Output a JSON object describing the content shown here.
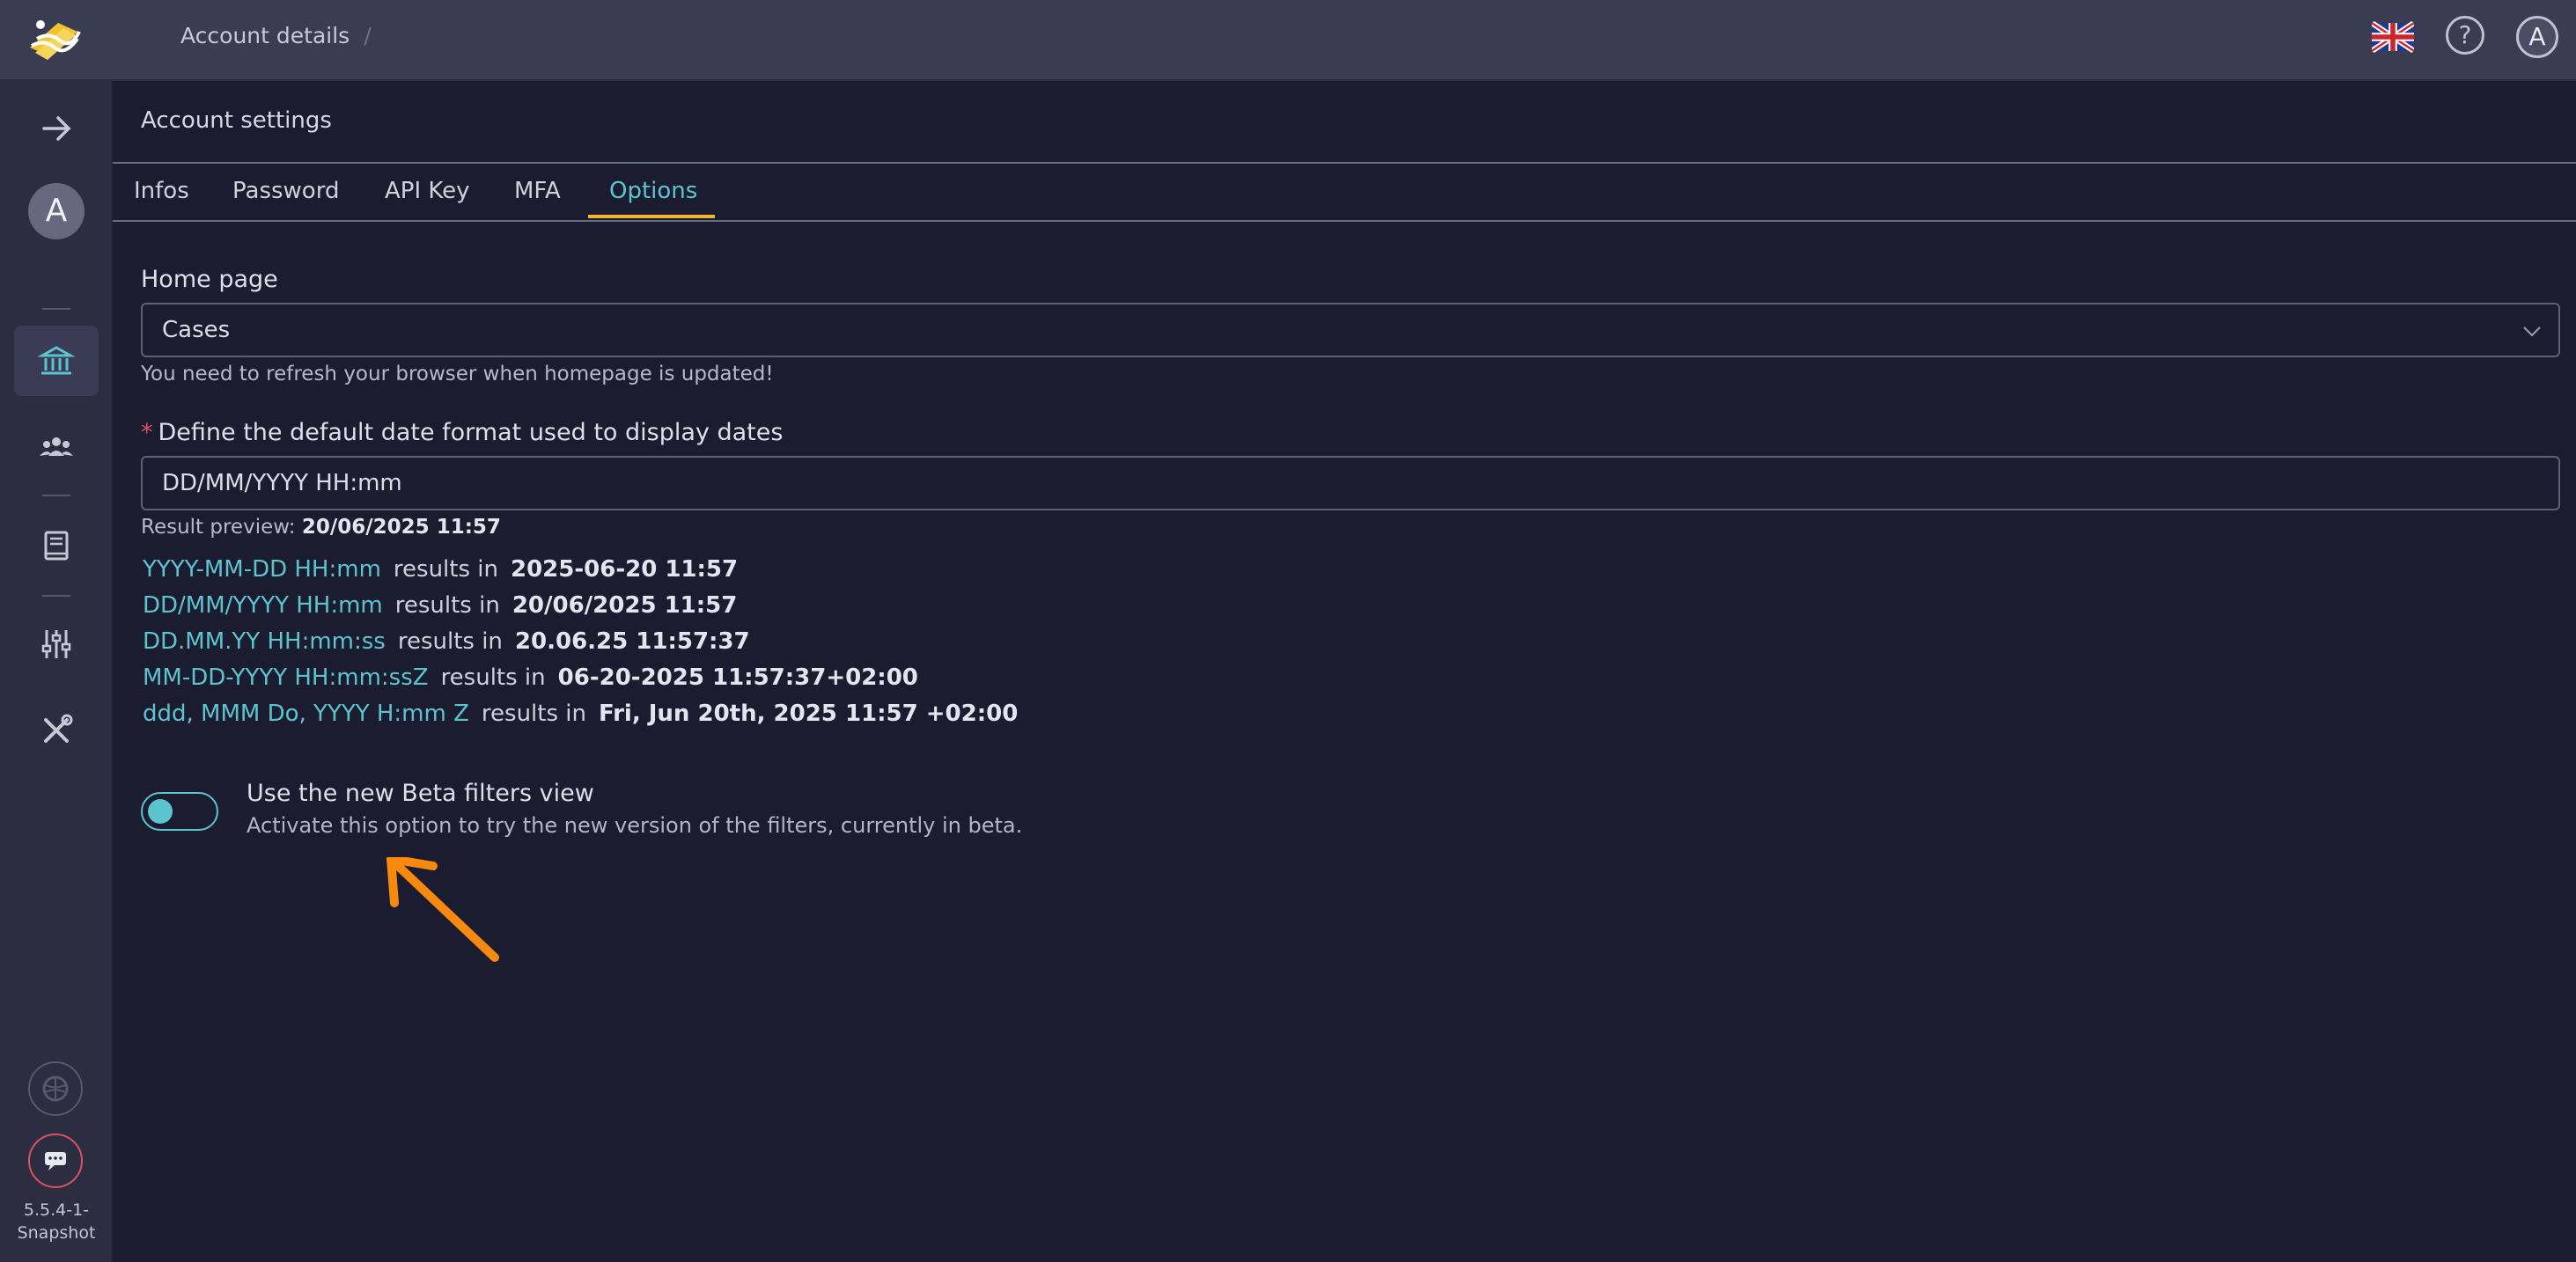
{
  "header": {
    "breadcrumb": "Account details",
    "breadcrumb_separator": "/",
    "help_icon": "?",
    "avatar_initial": "A"
  },
  "sidebar": {
    "avatar_initial": "A",
    "version": "5.5.4-1-\nSnapshot",
    "version_line1": "5.5.4-1-",
    "version_line2": "Snapshot"
  },
  "page": {
    "title": "Account settings"
  },
  "tabs": [
    {
      "label": "Infos"
    },
    {
      "label": "Password"
    },
    {
      "label": "API Key"
    },
    {
      "label": "MFA"
    },
    {
      "label": "Options"
    }
  ],
  "options": {
    "home_page": {
      "label": "Home page",
      "value": "Cases",
      "help": "You need to refresh your browser when homepage is updated!"
    },
    "date_format": {
      "required_mark": "*",
      "label": "Define the default date format used to display dates",
      "value": "DD/MM/YYYY HH:mm",
      "preview_label": "Result preview:",
      "preview_value": "20/06/2025 11:57"
    },
    "examples": [
      {
        "format": "YYYY-MM-DD HH:mm",
        "middle": "results in",
        "result": "2025-06-20 11:57"
      },
      {
        "format": "DD/MM/YYYY HH:mm",
        "middle": "results in",
        "result": "20/06/2025 11:57"
      },
      {
        "format": "DD.MM.YY HH:mm:ss",
        "middle": "results in",
        "result": "20.06.25 11:57:37"
      },
      {
        "format": "MM-DD-YYYY HH:mm:ssZ",
        "middle": "results in",
        "result": "06-20-2025 11:57:37+02:00"
      },
      {
        "format": "ddd, MMM Do, YYYY H:mm Z",
        "middle": "results in",
        "result": "Fri, Jun 20th, 2025 11:57 +02:00"
      }
    ],
    "beta_filters": {
      "title": "Use the new Beta filters view",
      "description": "Activate this option to try the new version of the filters, currently in beta.",
      "enabled": true
    }
  },
  "colors": {
    "accent": "#5bc4cf",
    "tab_underline": "#f0b72f",
    "annotation_arrow": "#f7890f",
    "background": "#1c1c30",
    "topbar": "#3a3c52",
    "sidebar": "#2c2d41"
  },
  "icons": {
    "logo": "logo-icon",
    "flag": "uk-flag-icon",
    "help": "help-icon",
    "expand": "arrow-right-icon",
    "organisation": "bank-icon",
    "users": "users-icon",
    "knowledge": "book-icon",
    "settings": "sliders-icon",
    "tools": "tools-icon",
    "cortex": "brain-icon",
    "chat": "chat-icon"
  }
}
